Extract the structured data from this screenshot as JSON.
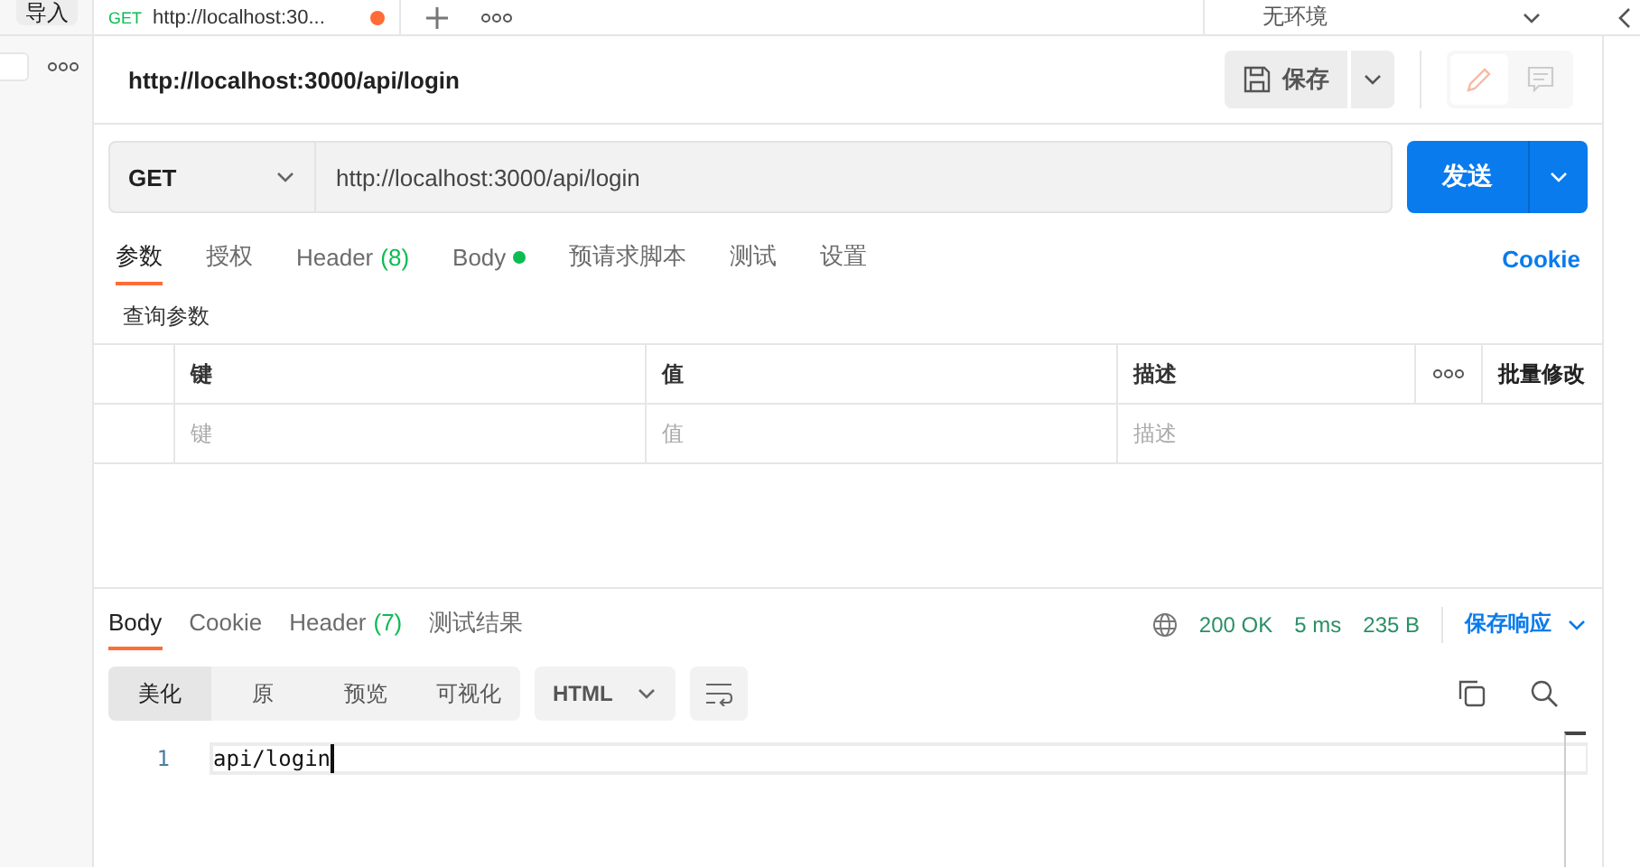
{
  "top_bar": {
    "import_button": "导入",
    "tab": {
      "method": "GET",
      "title": "http://localhost:30...",
      "unsaved": true
    },
    "environment": "无环境"
  },
  "request": {
    "title": "http://localhost:3000/api/login",
    "save_button": "保存",
    "method": "GET",
    "url": "http://localhost:3000/api/login",
    "send_button": "发送"
  },
  "request_tabs": [
    {
      "label": "参数",
      "selected": true
    },
    {
      "label": "授权",
      "selected": false
    },
    {
      "label": "Header",
      "count": "(8)",
      "selected": false
    },
    {
      "label": "Body",
      "has_content": true,
      "selected": false
    },
    {
      "label": "预请求脚本",
      "selected": false
    },
    {
      "label": "测试",
      "selected": false
    },
    {
      "label": "设置",
      "selected": false
    }
  ],
  "cookie_link": "Cookie",
  "query_params": {
    "title": "查询参数",
    "columns": [
      "键",
      "值",
      "描述"
    ],
    "bulk_edit": "批量修改",
    "placeholders": [
      "键",
      "值",
      "描述"
    ]
  },
  "response": {
    "tabs": [
      {
        "label": "Body",
        "selected": true
      },
      {
        "label": "Cookie",
        "selected": false
      },
      {
        "label": "Header",
        "count": "(7)",
        "selected": false
      },
      {
        "label": "测试结果",
        "selected": false
      }
    ],
    "status": "200 OK",
    "time": "5 ms",
    "size": "235 B",
    "save_response": "保存响应",
    "view_modes": [
      {
        "label": "美化",
        "selected": true
      },
      {
        "label": "原",
        "selected": false
      },
      {
        "label": "预览",
        "selected": false
      },
      {
        "label": "可视化",
        "selected": false
      }
    ],
    "format": "HTML",
    "lines": [
      {
        "number": "1",
        "text": "api/login"
      }
    ]
  }
}
